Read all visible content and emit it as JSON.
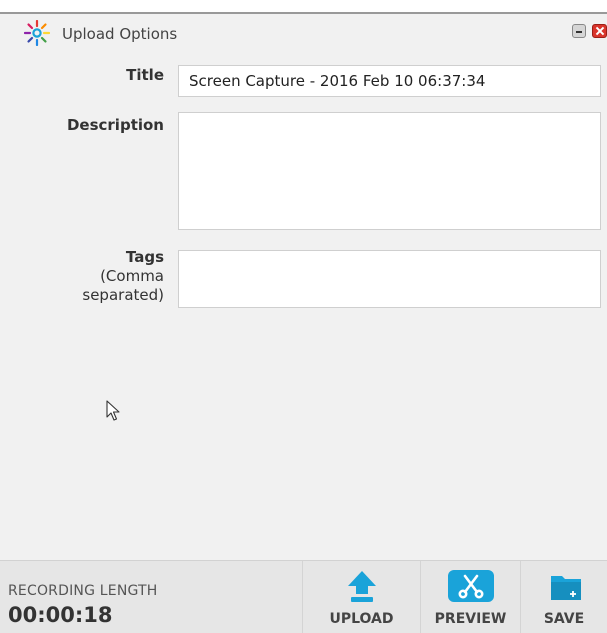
{
  "window": {
    "title": "Upload Options"
  },
  "form": {
    "title_label": "Title",
    "title_value": "Screen Capture - 2016 Feb 10 06:37:34",
    "description_label": "Description",
    "description_value": "",
    "tags_label": "Tags",
    "tags_hint_line1": "(Comma",
    "tags_hint_line2": "separated)",
    "tags_value": ""
  },
  "footer": {
    "recording_label": "RECORDING LENGTH",
    "recording_time": "00:00:18",
    "upload_label": "UPLOAD",
    "preview_label": "PREVIEW",
    "save_label": "SAVE"
  },
  "icons": {
    "logo": "sunburst-logo-icon",
    "upload": "upload-arrow-icon",
    "preview": "scissors-icon",
    "save": "folder-plus-icon"
  },
  "colors": {
    "accent_blue": "#1aa3d9",
    "close_red": "#d9342b",
    "panel_bg": "#f1f1f1",
    "footer_bg": "#e6e6e6"
  }
}
